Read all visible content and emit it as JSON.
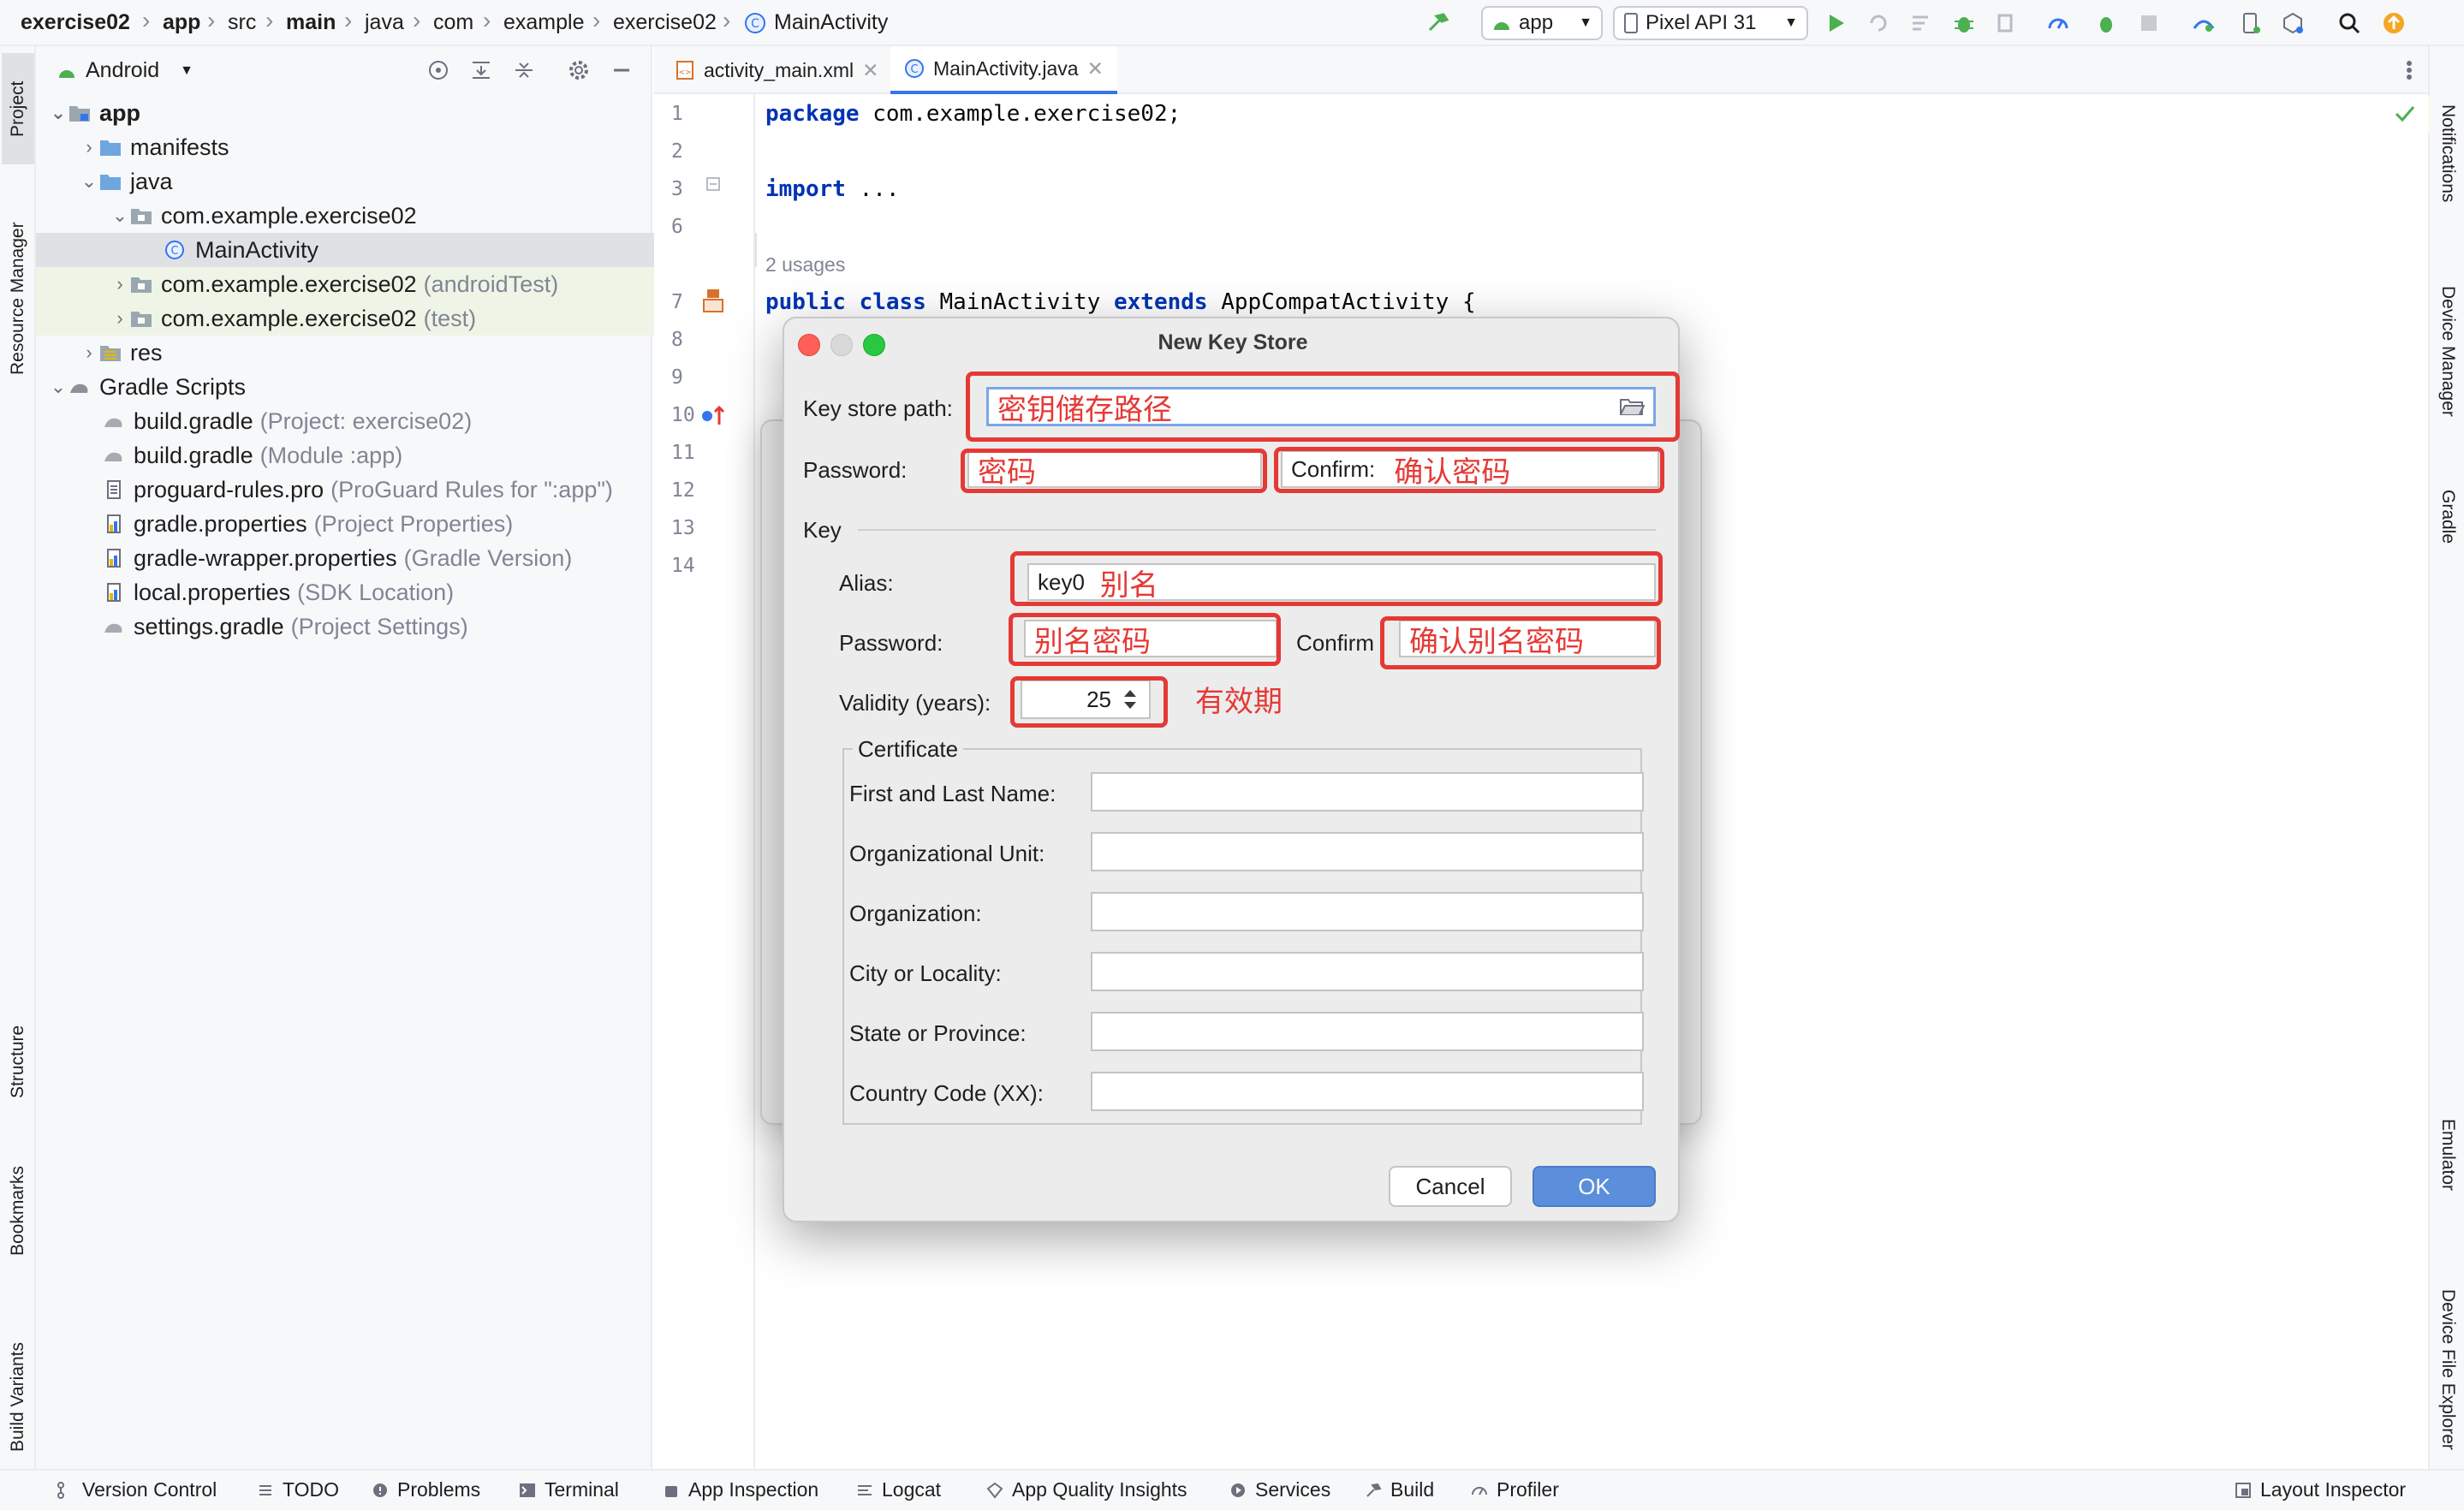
{
  "navbar": {
    "breadcrumbs": [
      "exercise02",
      "app",
      "src",
      "main",
      "java",
      "com",
      "example",
      "exercise02",
      "MainActivity"
    ],
    "run_config": "app",
    "device": "Pixel API 31"
  },
  "left_stripe": {
    "project": "Project",
    "resource_manager": "Resource Manager",
    "structure": "Structure",
    "bookmarks": "Bookmarks",
    "build_variants": "Build Variants"
  },
  "right_stripe": {
    "notifications": "Notifications",
    "device_manager": "Device Manager",
    "gradle": "Gradle",
    "emulator": "Emulator",
    "device_file_explorer": "Device File Explorer"
  },
  "project_panel": {
    "view_mode": "Android",
    "tree": [
      {
        "label": "app",
        "hint": ""
      },
      {
        "label": "manifests",
        "hint": ""
      },
      {
        "label": "java",
        "hint": ""
      },
      {
        "label": "com.example.exercise02",
        "hint": ""
      },
      {
        "label": "MainActivity",
        "hint": ""
      },
      {
        "label": "com.example.exercise02",
        "hint": "(androidTest)"
      },
      {
        "label": "com.example.exercise02",
        "hint": "(test)"
      },
      {
        "label": "res",
        "hint": ""
      },
      {
        "label": "Gradle Scripts",
        "hint": ""
      },
      {
        "label": "build.gradle",
        "hint": "(Project: exercise02)"
      },
      {
        "label": "build.gradle",
        "hint": "(Module :app)"
      },
      {
        "label": "proguard-rules.pro",
        "hint": "(ProGuard Rules for \":app\")"
      },
      {
        "label": "gradle.properties",
        "hint": "(Project Properties)"
      },
      {
        "label": "gradle-wrapper.properties",
        "hint": "(Gradle Version)"
      },
      {
        "label": "local.properties",
        "hint": "(SDK Location)"
      },
      {
        "label": "settings.gradle",
        "hint": "(Project Settings)"
      }
    ]
  },
  "editor": {
    "tabs": [
      {
        "label": "activity_main.xml"
      },
      {
        "label": "MainActivity.java"
      }
    ],
    "line_numbers": [
      "1",
      "2",
      "3",
      "6",
      "7",
      "8",
      "9",
      "10",
      "11",
      "12",
      "13",
      "14"
    ],
    "line1_kw": "package",
    "line1_rest": " com.example.exercise02;",
    "line3_kw": "import",
    "line3_rest": " ...",
    "usages": "2 usages",
    "line7_kw1": "public class",
    "line7_mid": " MainActivity ",
    "line7_kw2": "extends",
    "line7_rest": " AppCompatActivity {"
  },
  "dialog": {
    "title": "New Key Store",
    "key_store_path_label": "Key store path:",
    "key_store_path_note": "密钥储存路径",
    "password_label": "Password:",
    "password_note": "密码",
    "confirm_label": "Confirm:",
    "confirm_note": "确认密码",
    "key_section": "Key",
    "alias_label": "Alias:",
    "alias_value": "key0",
    "alias_note": "别名",
    "key_password_label": "Password:",
    "key_password_note": "别名密码",
    "key_confirm_label": "Confirm",
    "key_confirm_note": "确认别名密码",
    "validity_label": "Validity (years):",
    "validity_value": "25",
    "validity_note": "有效期",
    "certificate_section": "Certificate",
    "cert_fields": [
      {
        "label": "First and Last Name:"
      },
      {
        "label": "Organizational Unit:"
      },
      {
        "label": "Organization:"
      },
      {
        "label": "City or Locality:"
      },
      {
        "label": "State or Province:"
      },
      {
        "label": "Country Code (XX):"
      }
    ],
    "cancel": "Cancel",
    "ok": "OK"
  },
  "bottom_bar": {
    "version_control": "Version Control",
    "todo": "TODO",
    "problems": "Problems",
    "terminal": "Terminal",
    "app_inspection": "App Inspection",
    "logcat": "Logcat",
    "app_quality_insights": "App Quality Insights",
    "services": "Services",
    "build": "Build",
    "profiler": "Profiler",
    "layout_inspector": "Layout Inspector"
  },
  "colors": {
    "accent": "#3574f0",
    "annotation_red": "#e53935",
    "ok_button": "#5b8edb",
    "run_green": "#4caf50"
  }
}
